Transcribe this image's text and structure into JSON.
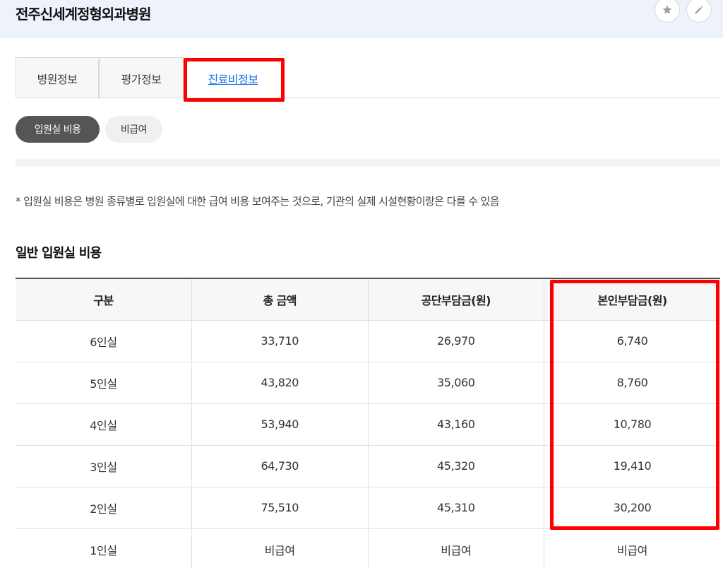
{
  "header": {
    "hospital_name": "전주신세계정형외과병원",
    "star_icon": "star-icon",
    "edit_icon": "pencil-icon"
  },
  "tabs": [
    {
      "label": "병원정보",
      "active": false
    },
    {
      "label": "평가정보",
      "active": false
    },
    {
      "label": "진료비정보",
      "active": true
    }
  ],
  "subtabs": [
    {
      "label": "입원실 비용",
      "active": true
    },
    {
      "label": "비급여",
      "active": false
    }
  ],
  "notice": "* 입원실 비용은 병원 종류별로 입원실에 대한 급여 비용 보여주는 것으로, 기관의 실제 시설현황이랑은 다를 수 있음",
  "section_title": "일반 입원실 비용",
  "table": {
    "headers": [
      "구분",
      "총 금액",
      "공단부담금(원)",
      "본인부담금(원)"
    ],
    "rows": [
      [
        "6인실",
        "33,710",
        "26,970",
        "6,740"
      ],
      [
        "5인실",
        "43,820",
        "35,060",
        "8,760"
      ],
      [
        "4인실",
        "53,940",
        "43,160",
        "10,780"
      ],
      [
        "3인실",
        "64,730",
        "45,320",
        "19,410"
      ],
      [
        "2인실",
        "75,510",
        "45,310",
        "30,200"
      ],
      [
        "1인실",
        "비급여",
        "비급여",
        "비급여"
      ]
    ]
  },
  "colors": {
    "highlight": "#ff0000",
    "active_tab_text": "#1a73e8",
    "header_bg": "#eef3fb"
  }
}
